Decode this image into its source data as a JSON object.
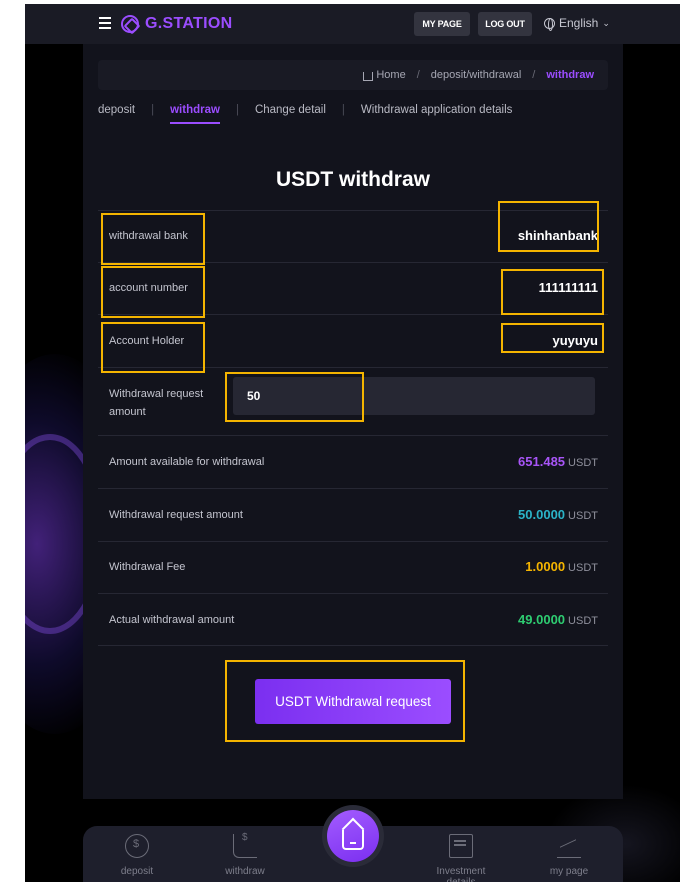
{
  "header": {
    "logo_text": "G.STATION",
    "my_page_label": "MY PAGE",
    "logout_label": "LOG OUT",
    "language": "English"
  },
  "breadcrumb": {
    "home": "Home",
    "section": "deposit/withdrawal",
    "current": "withdraw"
  },
  "tabs": [
    {
      "label": "deposit",
      "active": false
    },
    {
      "label": "withdraw",
      "active": true
    },
    {
      "label": "Change detail",
      "active": false
    },
    {
      "label": "Withdrawal application details",
      "active": false
    }
  ],
  "form": {
    "title": "USDT withdraw",
    "withdrawal_bank_label": "withdrawal bank",
    "withdrawal_bank_value": "shinhanbank",
    "account_number_label": "account number",
    "account_number_value": "111111111",
    "account_holder_label": "Account Holder",
    "account_holder_value": "yuyuyu",
    "request_amount_label_line1": "Withdrawal request",
    "request_amount_label_line2": "amount",
    "request_amount_input_value": "50"
  },
  "summary": {
    "available_label": "Amount available for withdrawal",
    "available_value": "651.485",
    "request_label": "Withdrawal request amount",
    "request_value": "50.0000",
    "fee_label": "Withdrawal Fee",
    "fee_value": "1.0000",
    "actual_label": "Actual withdrawal amount",
    "actual_value": "49.0000",
    "unit": "USDT"
  },
  "submit_label": "USDT Withdrawal request",
  "bottom_nav": {
    "deposit": "deposit",
    "withdraw": "withdraw",
    "investment": "Investment details",
    "mypage": "my page"
  },
  "colors": {
    "accent": "#9b4dff",
    "available": "#a855f7",
    "request": "#2bb3c7",
    "fee": "#f4b400",
    "actual": "#2ecc71",
    "highlight_box": "#f4b400"
  }
}
